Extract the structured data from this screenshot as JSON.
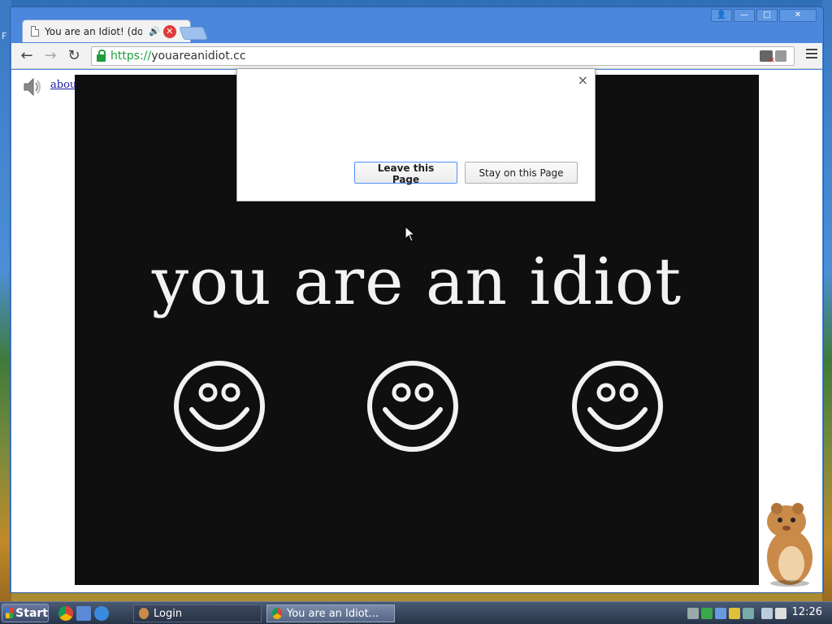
{
  "browser": {
    "tab_title": "You are an Idiot! (dot",
    "url_scheme": "https://",
    "url_host": "youareanidiot.cc",
    "window_buttons": {
      "user": "👤",
      "minimize": "—",
      "maximize": "□",
      "close": "✕"
    }
  },
  "page": {
    "about_link": "about:blank",
    "headline": "you are an idiot",
    "smiley_count": 3
  },
  "dialog": {
    "close_glyph": "×",
    "leave_label": "Leave this Page",
    "stay_label": "Stay on this Page"
  },
  "taskbar": {
    "start_label": "Start",
    "items": [
      {
        "label": "Login",
        "active": false
      },
      {
        "label": "You are an Idiot...",
        "active": true
      }
    ],
    "clock": "12:26"
  },
  "colors": {
    "stage_bg": "#0f0f0f",
    "headline": "#f2f2f2",
    "secure": "#1f9e3a",
    "tab_close": "#e03a3a"
  }
}
